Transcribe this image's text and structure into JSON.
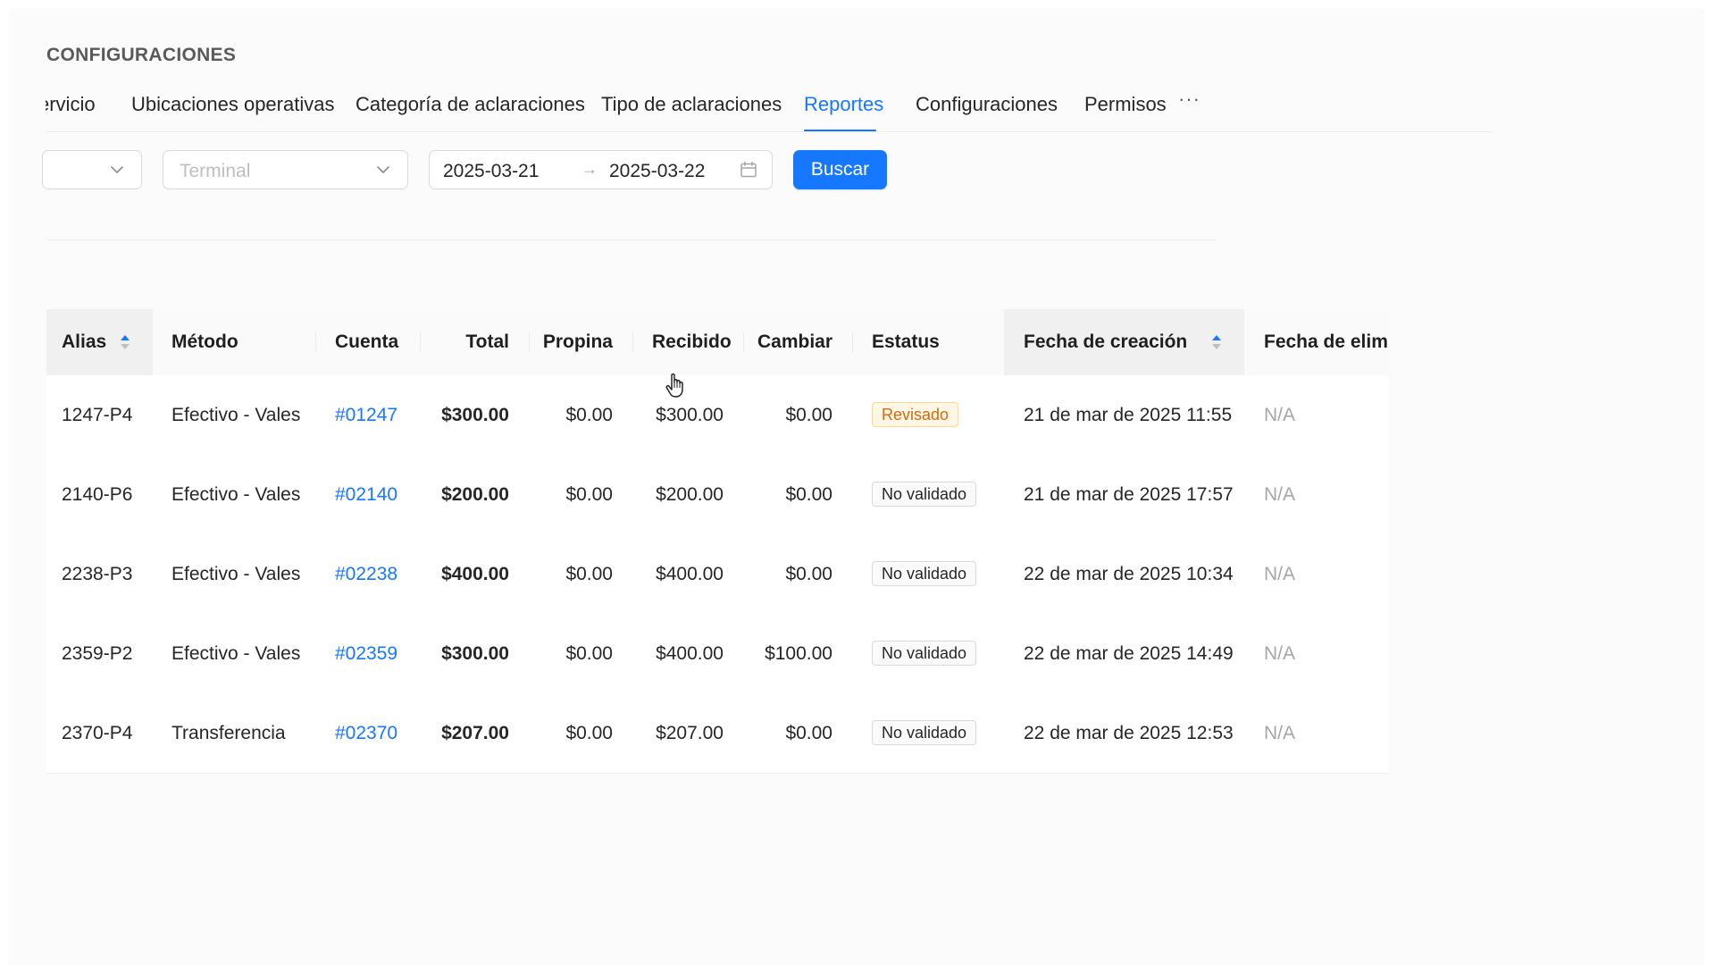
{
  "header": {
    "section_title": "CONFIGURACIONES"
  },
  "tabs": [
    {
      "label": "ervicio",
      "active": false
    },
    {
      "label": "Ubicaciones operativas",
      "active": false
    },
    {
      "label": "Categoría de aclaraciones",
      "active": false
    },
    {
      "label": "Tipo de aclaraciones",
      "active": false
    },
    {
      "label": "Reportes",
      "active": true
    },
    {
      "label": "Configuraciones",
      "active": false
    },
    {
      "label": "Permisos",
      "active": false
    }
  ],
  "tabs_more": "···",
  "filters": {
    "first_select_value": "",
    "terminal_placeholder": "Terminal",
    "date_start": "2025-03-21",
    "date_end": "2025-03-22",
    "date_separator": "→",
    "search_label": "Buscar"
  },
  "table": {
    "columns": [
      "Alias",
      "Método",
      "Cuenta",
      "Total",
      "Propina",
      "Recibido",
      "Cambiar",
      "Estatus",
      "Fecha de creación",
      "Fecha de elimin"
    ],
    "rows": [
      {
        "alias": "1247-P4",
        "metodo": "Efectivo - Vales",
        "cuenta": "#01247",
        "total": "$300.00",
        "propina": "$0.00",
        "recibido": "$300.00",
        "cambiar": "$0.00",
        "estatus": "Revisado",
        "estatus_type": "warn",
        "fecha_creacion": "21 de mar de 2025 11:55",
        "fecha_eliminacion": "N/A"
      },
      {
        "alias": "2140-P6",
        "metodo": "Efectivo - Vales",
        "cuenta": "#02140",
        "total": "$200.00",
        "propina": "$0.00",
        "recibido": "$200.00",
        "cambiar": "$0.00",
        "estatus": "No validado",
        "estatus_type": "neutral",
        "fecha_creacion": "21 de mar de 2025 17:57",
        "fecha_eliminacion": "N/A"
      },
      {
        "alias": "2238-P3",
        "metodo": "Efectivo - Vales",
        "cuenta": "#02238",
        "total": "$400.00",
        "propina": "$0.00",
        "recibido": "$400.00",
        "cambiar": "$0.00",
        "estatus": "No validado",
        "estatus_type": "neutral",
        "fecha_creacion": "22 de mar de 2025 10:34",
        "fecha_eliminacion": "N/A"
      },
      {
        "alias": "2359-P2",
        "metodo": "Efectivo - Vales",
        "cuenta": "#02359",
        "total": "$300.00",
        "propina": "$0.00",
        "recibido": "$400.00",
        "cambiar": "$100.00",
        "estatus": "No validado",
        "estatus_type": "neutral",
        "fecha_creacion": "22 de mar de 2025 14:49",
        "fecha_eliminacion": "N/A"
      },
      {
        "alias": "2370-P4",
        "metodo": "Transferencia",
        "cuenta": "#02370",
        "total": "$207.00",
        "propina": "$0.00",
        "recibido": "$207.00",
        "cambiar": "$0.00",
        "estatus": "No validado",
        "estatus_type": "neutral",
        "fecha_creacion": "22 de mar de 2025 12:53",
        "fecha_eliminacion": "N/A"
      }
    ]
  },
  "icons": {
    "select_arrow": "chevron-down-icon",
    "date_picker": "calendar-icon",
    "sort": "sort-icon",
    "pointer": "hand-pointer-icon"
  },
  "colors": {
    "accent": "#1677ff",
    "warn_text": "#d46b08",
    "warn_bg": "#fff7e6"
  }
}
